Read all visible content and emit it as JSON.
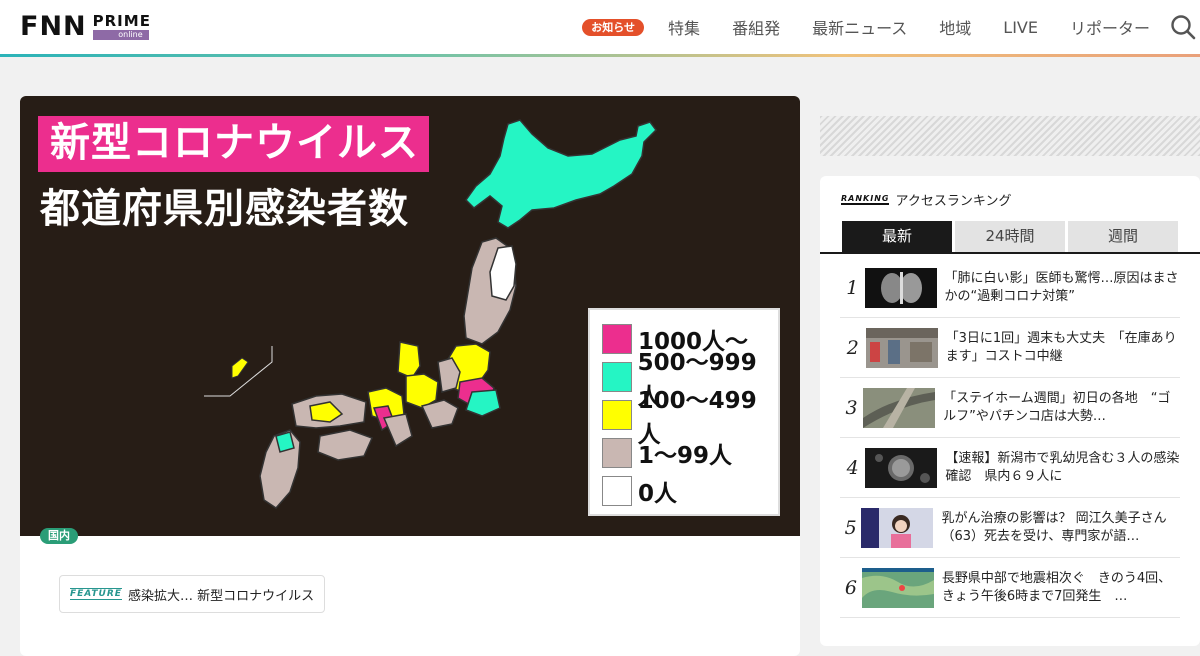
{
  "header": {
    "logo_main": "FNN",
    "logo_prime": "PRIME",
    "logo_online": "online",
    "notice": "お知らせ",
    "nav": [
      "特集",
      "番組発",
      "最新ニュース",
      "地域",
      "LIVE",
      "リポーター"
    ]
  },
  "hero": {
    "title_line1": "新型コロナウイルス",
    "title_line2": "都道府県別感染者数",
    "legend": [
      {
        "label": "1000人〜",
        "color": "#ec2e8e"
      },
      {
        "label": "500〜999人",
        "color": "#25f5c4"
      },
      {
        "label": "100〜499人",
        "color": "#ffff00"
      },
      {
        "label": "1〜99人",
        "color": "#c9b7b2"
      },
      {
        "label": "0人",
        "color": "#ffffff"
      }
    ]
  },
  "article": {
    "category": "国内",
    "feature_tag": "FEATURE",
    "feature_title": "感染拡大… 新型コロナウイルス"
  },
  "ranking": {
    "logo": "RANKING",
    "title": "アクセスランキング",
    "tabs": [
      "最新",
      "24時間",
      "週間"
    ],
    "items": [
      {
        "rank": "1",
        "text": "「肺に白い影」医師も驚愕…原因はまさかの“過剰コロナ対策”"
      },
      {
        "rank": "2",
        "text": "「3日に1回」週末も大丈夫　「在庫あります」コストコ中継"
      },
      {
        "rank": "3",
        "text": "「ステイホーム週間」初日の各地　“ゴルフ”やパチンコ店は大勢…"
      },
      {
        "rank": "4",
        "text": "【速報】新潟市で乳幼児含む３人の感染確認　県内６９人に"
      },
      {
        "rank": "5",
        "text": "乳がん治療の影響は？ 岡江久美子さん（63）死去を受け、専門家が語…"
      },
      {
        "rank": "6",
        "text": "長野県中部で地震相次ぐ　きのう4回、きょう午後6時まで7回発生　…"
      }
    ]
  }
}
